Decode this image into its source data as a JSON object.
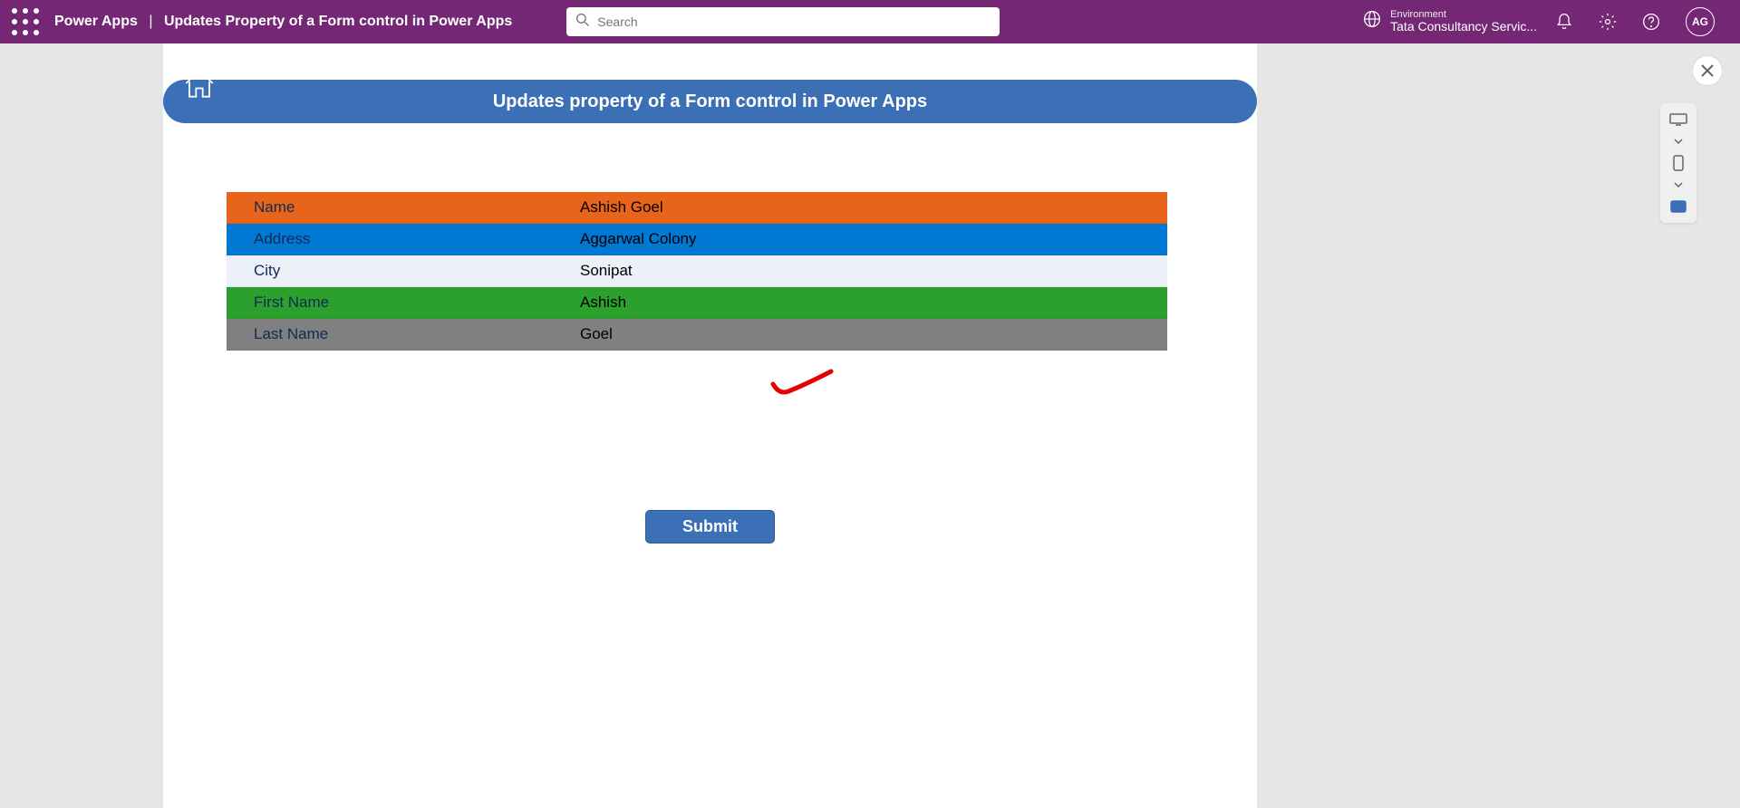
{
  "header": {
    "app_name": "Power Apps",
    "separator": "|",
    "page_title": "Updates Property of a Form control in Power Apps",
    "search_placeholder": "Search",
    "env_label": "Environment",
    "env_value": "Tata Consultancy Servic...",
    "avatar_initials": "AG"
  },
  "banner": {
    "title": "Updates property of a Form control in Power Apps"
  },
  "form": {
    "rows": [
      {
        "label": "Name",
        "value": "Ashish Goel"
      },
      {
        "label": "Address",
        "value": "Aggarwal Colony"
      },
      {
        "label": "City",
        "value": "Sonipat"
      },
      {
        "label": "First Name",
        "value": "Ashish"
      },
      {
        "label": "Last Name",
        "value": "Goel"
      }
    ]
  },
  "buttons": {
    "submit": "Submit"
  },
  "colors": {
    "header_bg": "#742774",
    "banner_bg": "#3b6fb6",
    "row0": "#e8641b",
    "row1": "#0078d4",
    "row2": "#ecf0f9",
    "row3": "#2ca02c",
    "row4": "#808080",
    "annotation": "#e60000"
  }
}
